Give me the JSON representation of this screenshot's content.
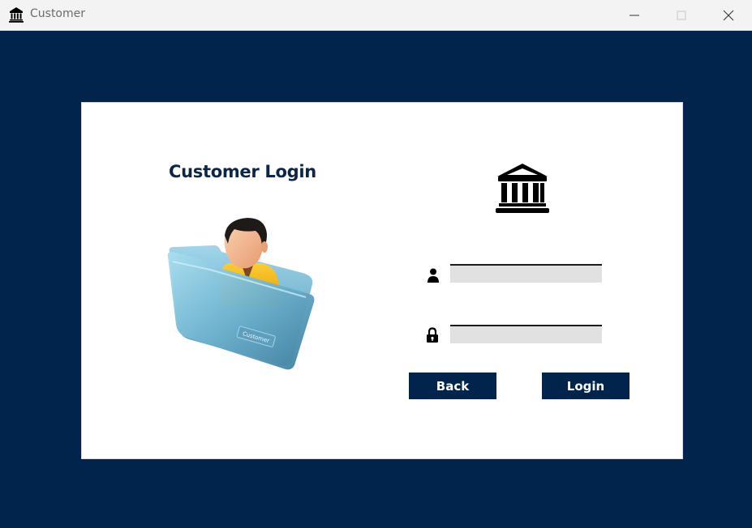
{
  "window": {
    "title": "Customer",
    "app_icon": "bank-icon",
    "controls": {
      "minimize": "minimize-icon",
      "maximize": "maximize-icon",
      "close": "close-icon"
    }
  },
  "login": {
    "heading": "Customer Login",
    "illustration_icon": "customer-folder-illustration",
    "folder_tag": "Customer",
    "logo_icon": "bank-icon",
    "username": {
      "icon": "user-icon",
      "value": "",
      "placeholder": ""
    },
    "password": {
      "icon": "lock-icon",
      "value": "",
      "placeholder": ""
    },
    "back_label": "Back",
    "login_label": "Login"
  },
  "colors": {
    "background": "#00244b",
    "card": "#ffffff",
    "button": "#00244b",
    "heading": "#0b2648",
    "input_fill": "#e1e1e1"
  }
}
